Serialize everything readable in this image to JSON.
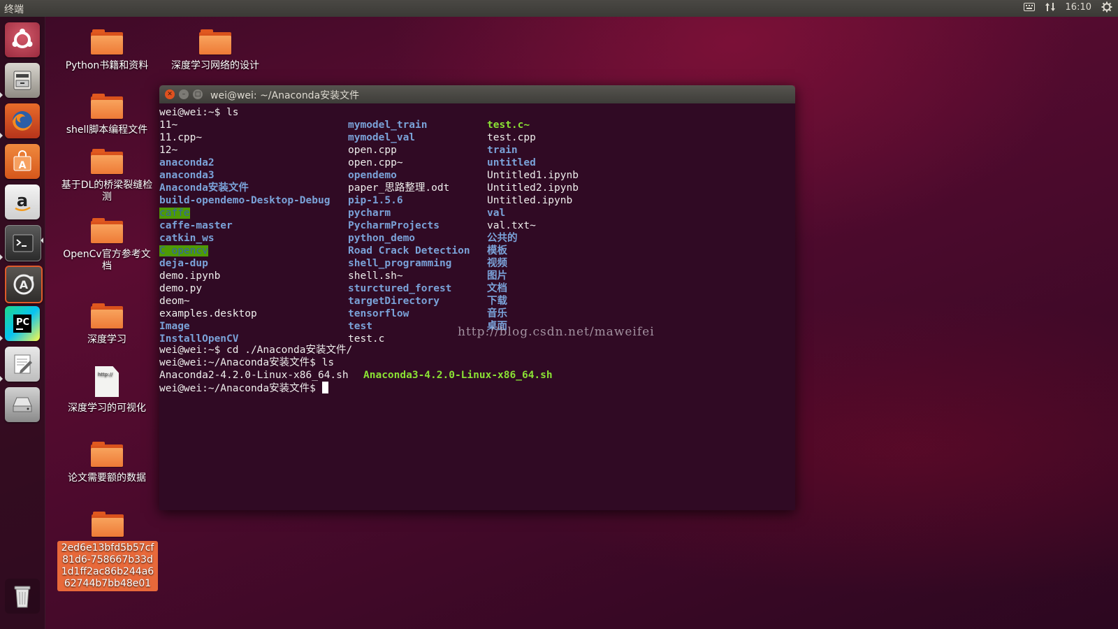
{
  "top_panel": {
    "app_title": "终端",
    "clock": "16:10",
    "keyboard_icon": "keyboard-icon",
    "network_icon": "network-updown-icon",
    "settings_icon": "gear-icon"
  },
  "launcher": {
    "items": [
      {
        "name": "dash-home",
        "icon": "ubuntu-logo-icon"
      },
      {
        "name": "files",
        "icon": "file-cabinet-icon"
      },
      {
        "name": "firefox",
        "icon": "firefox-icon"
      },
      {
        "name": "software-center",
        "icon": "shopping-bag-icon"
      },
      {
        "name": "amazon",
        "icon": "amazon-icon"
      },
      {
        "name": "terminal",
        "icon": "terminal-icon"
      },
      {
        "name": "software-updater",
        "icon": "updater-icon"
      },
      {
        "name": "pycharm",
        "icon": "pycharm-icon"
      },
      {
        "name": "text-editor",
        "icon": "text-editor-icon"
      },
      {
        "name": "disk",
        "icon": "drive-icon"
      },
      {
        "name": "trash",
        "icon": "trash-icon"
      }
    ]
  },
  "desktop": {
    "icons": [
      {
        "label": "Python书籍和资料",
        "type": "folder"
      },
      {
        "label": "深度学习网络的设计",
        "type": "folder"
      },
      {
        "label": "shell脚本编程文件",
        "type": "folder"
      },
      {
        "label": "基于DL的桥梁裂缝检测",
        "type": "folder"
      },
      {
        "label": "OpenCv官方参考文档",
        "type": "folder"
      },
      {
        "label": "深度学习",
        "type": "folder"
      },
      {
        "label": "深度学习的可视化",
        "type": "document",
        "doc_text": "http://"
      },
      {
        "label": "论文需要额的数据",
        "type": "folder"
      },
      {
        "label": "2ed6e13bfd5b57cf81d6-758667b33d1d1ff2ac86b244a662744b7bb48e01",
        "type": "folder",
        "selected": true
      }
    ]
  },
  "terminal": {
    "title": "wei@wei: ~/Anaconda安装文件",
    "prompt_home": "wei@wei:~$ ",
    "prompt_dir": "wei@wei:~/Anaconda安装文件$ ",
    "cmd_ls": "ls",
    "cmd_cd": "cd ./Anaconda安装文件/",
    "col1": [
      {
        "text": "11~",
        "style": "white"
      },
      {
        "text": "11.cpp~",
        "style": "white"
      },
      {
        "text": "12~",
        "style": "white"
      },
      {
        "text": "anaconda2",
        "style": "blue"
      },
      {
        "text": "anaconda3",
        "style": "blue"
      },
      {
        "text": "Anaconda安装文件",
        "style": "blue"
      },
      {
        "text": "build-opendemo-Desktop-Debug",
        "style": "blue"
      },
      {
        "text": "caffe",
        "style": "hl"
      },
      {
        "text": "caffe-master",
        "style": "blue"
      },
      {
        "text": "catkin_ws",
        "style": "blue"
      },
      {
        "text": "C_opencv",
        "style": "hl"
      },
      {
        "text": "deja-dup",
        "style": "blue"
      },
      {
        "text": "demo.ipynb",
        "style": "white"
      },
      {
        "text": "demo.py",
        "style": "white"
      },
      {
        "text": "deom~",
        "style": "white"
      },
      {
        "text": "examples.desktop",
        "style": "white"
      },
      {
        "text": "Image",
        "style": "blue"
      },
      {
        "text": "InstallOpenCV",
        "style": "blue"
      }
    ],
    "col2": [
      {
        "text": "mymodel_train",
        "style": "blue"
      },
      {
        "text": "mymodel_val",
        "style": "blue"
      },
      {
        "text": "open.cpp",
        "style": "white"
      },
      {
        "text": "open.cpp~",
        "style": "white"
      },
      {
        "text": "opendemo",
        "style": "blue"
      },
      {
        "text": "paper_思路整理.odt",
        "style": "white"
      },
      {
        "text": "pip-1.5.6",
        "style": "blue"
      },
      {
        "text": "pycharm",
        "style": "blue"
      },
      {
        "text": "PycharmProjects",
        "style": "blue"
      },
      {
        "text": "python_demo",
        "style": "blue"
      },
      {
        "text": "Road Crack Detection",
        "style": "blue"
      },
      {
        "text": "shell_programming",
        "style": "blue"
      },
      {
        "text": "shell.sh~",
        "style": "white"
      },
      {
        "text": "sturctured_forest",
        "style": "blue"
      },
      {
        "text": "targetDirectory",
        "style": "blue"
      },
      {
        "text": "tensorflow",
        "style": "blue"
      },
      {
        "text": "test",
        "style": "blue"
      },
      {
        "text": "test.c",
        "style": "white"
      }
    ],
    "col3": [
      {
        "text": "test.c~",
        "style": "green"
      },
      {
        "text": "test.cpp",
        "style": "white"
      },
      {
        "text": "train",
        "style": "blue"
      },
      {
        "text": "untitled",
        "style": "blue"
      },
      {
        "text": "Untitled1.ipynb",
        "style": "white"
      },
      {
        "text": "Untitled2.ipynb",
        "style": "white"
      },
      {
        "text": "Untitled.ipynb",
        "style": "white"
      },
      {
        "text": "val",
        "style": "blue"
      },
      {
        "text": "val.txt~",
        "style": "white"
      },
      {
        "text": "公共的",
        "style": "blue"
      },
      {
        "text": "模板",
        "style": "blue"
      },
      {
        "text": "视频",
        "style": "blue"
      },
      {
        "text": "图片",
        "style": "blue"
      },
      {
        "text": "文档",
        "style": "blue"
      },
      {
        "text": "下载",
        "style": "blue"
      },
      {
        "text": "音乐",
        "style": "blue"
      },
      {
        "text": "桌面",
        "style": "blue"
      }
    ],
    "ls2_file1": "Anaconda2-4.2.0-Linux-x86_64.sh",
    "ls2_file2": "Anaconda3-4.2.0-Linux-x86_64.sh",
    "watermark": "http://blog.csdn.net/maweifei"
  }
}
